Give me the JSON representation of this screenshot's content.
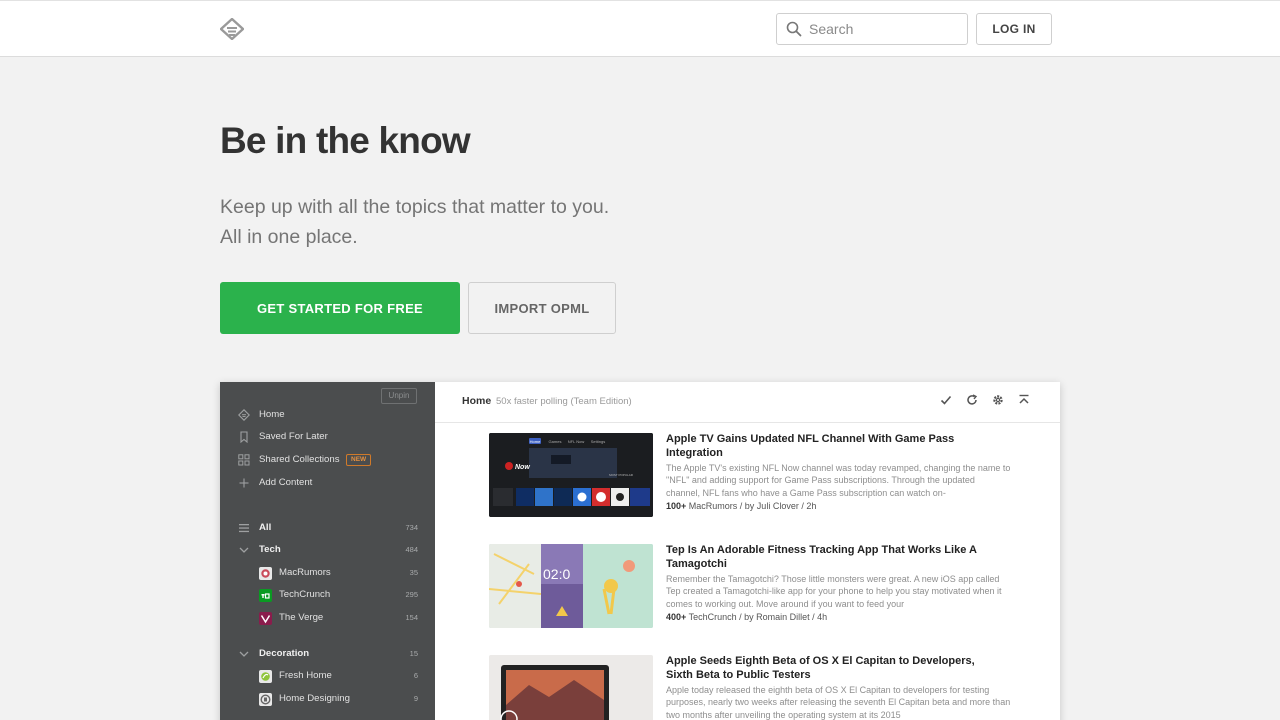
{
  "topbar": {
    "search_placeholder": "Search",
    "login_label": "LOG IN"
  },
  "hero": {
    "title": "Be in the know",
    "subtitle_line1": "Keep up with all the topics that matter to you.",
    "subtitle_line2": "All in one place.",
    "cta_primary": "GET STARTED FOR FREE",
    "cta_secondary": "IMPORT OPML"
  },
  "colors": {
    "brand_green": "#2bb24c",
    "sidebar_bg": "#4b4d4e"
  },
  "preview": {
    "sidebar": {
      "unpin_label": "Unpin",
      "nav": [
        {
          "label": "Home",
          "icon": "home-icon"
        },
        {
          "label": "Saved For Later",
          "icon": "bookmark-icon"
        },
        {
          "label": "Shared Collections",
          "icon": "collections-icon",
          "badge": "NEW"
        },
        {
          "label": "Add Content",
          "icon": "plus-icon"
        }
      ],
      "feeds": [
        {
          "label": "All",
          "count": "734",
          "icon": "list-icon"
        },
        {
          "label": "Tech",
          "count": "484",
          "icon": "chevron-down-icon"
        },
        {
          "label": "MacRumors",
          "count": "35",
          "icon": "macrumors-favicon"
        },
        {
          "label": "TechCrunch",
          "count": "295",
          "icon": "techcrunch-favicon"
        },
        {
          "label": "The Verge",
          "count": "154",
          "icon": "verge-favicon"
        },
        {
          "label": "Decoration",
          "count": "15",
          "icon": "chevron-down-icon"
        },
        {
          "label": "Fresh Home",
          "count": "6",
          "icon": "freshhome-favicon"
        },
        {
          "label": "Home Designing",
          "count": "9",
          "icon": "homedesigning-favicon"
        }
      ]
    },
    "main": {
      "title": "Home",
      "subtitle": "50x faster polling (Team Edition)",
      "articles": [
        {
          "title": "Apple TV Gains Updated NFL Channel With Game Pass Integration",
          "excerpt": "The Apple TV's existing NFL Now channel was today revamped, changing the name to \"NFL\" and adding support for Game Pass subscriptions. Through the updated channel, NFL fans who have a Game Pass subscription can watch on-",
          "count": "100+",
          "meta": "MacRumors / by Juli Clover / 2h"
        },
        {
          "title": "Tep Is An Adorable Fitness Tracking App That Works Like A Tamagotchi",
          "excerpt": "Remember the Tamagotchi? Those little monsters were great. A new iOS app called Tep created a Tamagotchi-like app for your phone to help you stay motivated when it comes to working out. Move around if you want to feed your",
          "count": "400+",
          "meta": "TechCrunch / by Romain Dillet / 4h"
        },
        {
          "title": "Apple Seeds Eighth Beta of OS X El Capitan to Developers, Sixth Beta to Public Testers",
          "excerpt": "Apple today released the eighth beta of OS X El Capitan to developers for testing purposes, nearly two weeks after releasing the seventh El Capitan beta and more than two months after unveiling the operating system at its 2015",
          "count": "",
          "meta": ""
        }
      ],
      "thumb_text": {
        "a1_nav1": "Home",
        "a1_nav2": "Games",
        "a1_nav3": "NFL Now",
        "a1_nav4": "Settings",
        "a1_brand": "Now",
        "a1_popular": "MOST POPULAR",
        "a2_time": "02:0"
      }
    }
  }
}
